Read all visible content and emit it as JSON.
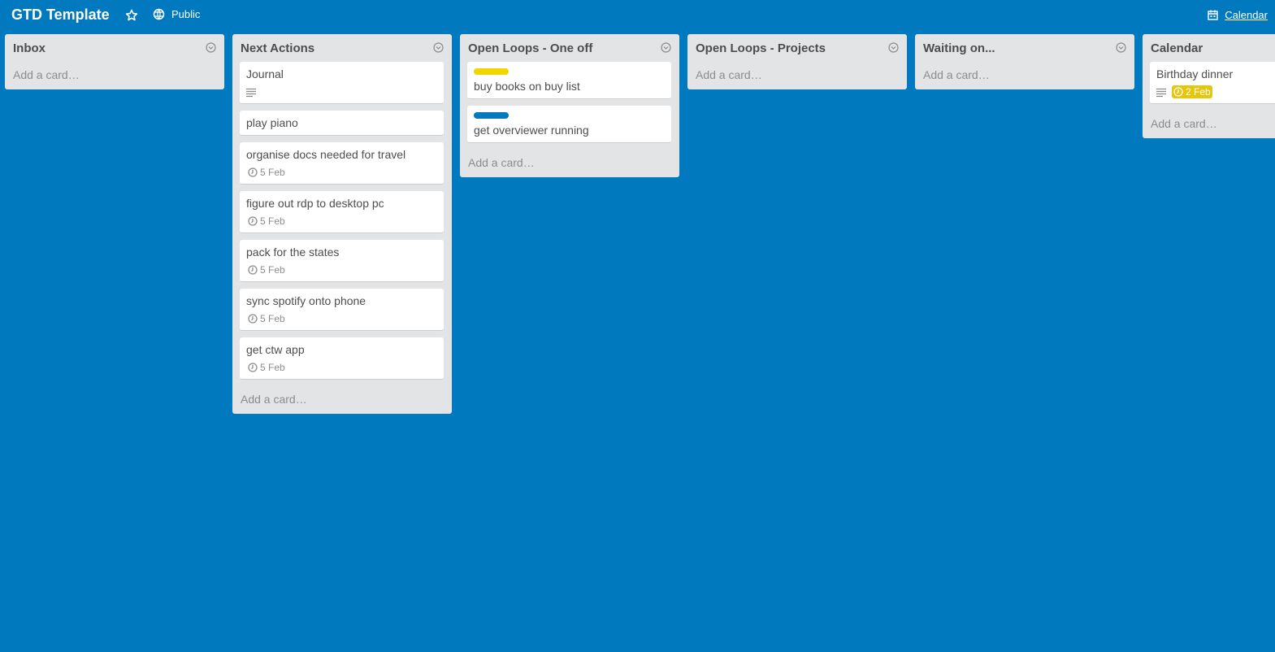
{
  "header": {
    "board_title": "GTD Template",
    "visibility_label": "Public",
    "calendar_label": "Calendar"
  },
  "add_card_label": "Add a card…",
  "colors": {
    "background": "#0079bf",
    "list_bg": "#e2e4e6",
    "label_yellow": "#f2d600",
    "label_blue": "#0079bf",
    "due_soon": "#e6c60d"
  },
  "lists": [
    {
      "title": "Inbox",
      "cards": []
    },
    {
      "title": "Next Actions",
      "cards": [
        {
          "title": "Journal",
          "has_description": true
        },
        {
          "title": "play piano"
        },
        {
          "title": "organise docs needed for travel",
          "due": "5 Feb"
        },
        {
          "title": "figure out rdp to desktop pc",
          "due": "5 Feb"
        },
        {
          "title": "pack for the states",
          "due": "5 Feb"
        },
        {
          "title": "sync spotify onto phone",
          "due": "5 Feb"
        },
        {
          "title": "get ctw app",
          "due": "5 Feb"
        }
      ]
    },
    {
      "title": "Open Loops - One off",
      "cards": [
        {
          "title": "buy books on buy list",
          "label_color": "yellow"
        },
        {
          "title": "get overviewer running",
          "label_color": "blue"
        }
      ]
    },
    {
      "title": "Open Loops - Projects",
      "cards": []
    },
    {
      "title": "Waiting on...",
      "cards": []
    },
    {
      "title": "Calendar",
      "cards": [
        {
          "title": "Birthday dinner",
          "has_description": true,
          "due": "2 Feb",
          "due_soon": true
        }
      ]
    }
  ]
}
